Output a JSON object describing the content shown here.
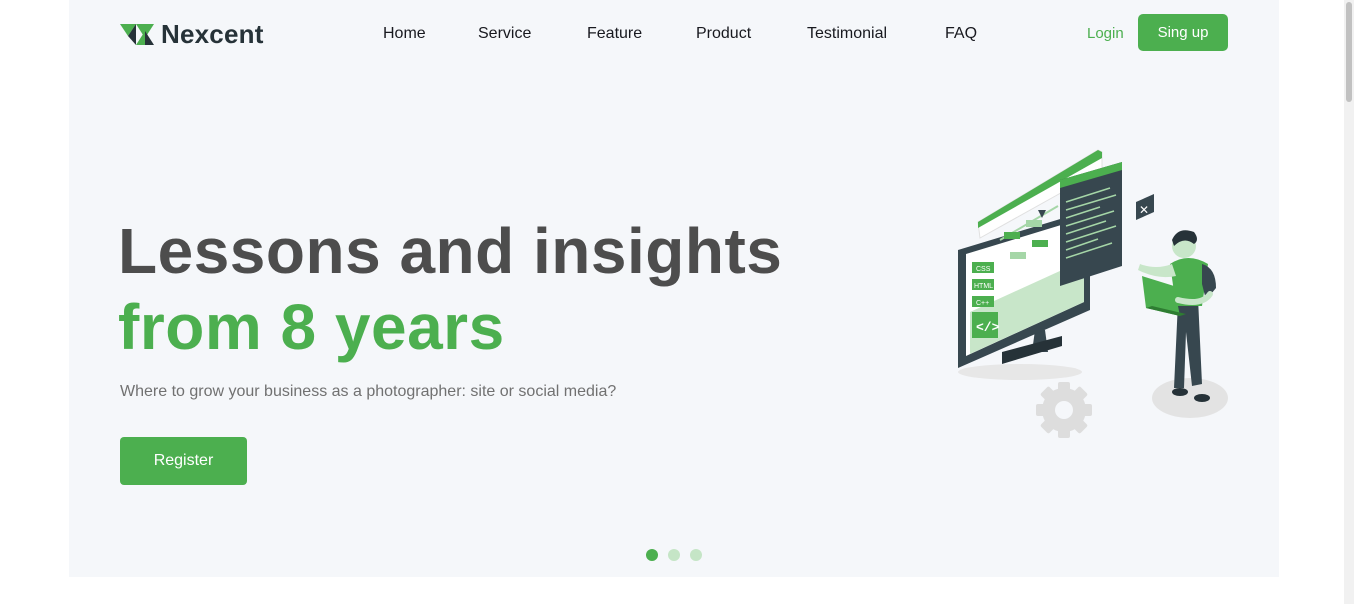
{
  "brand": {
    "name": "Nexcent",
    "accent": "#4caf4f",
    "dark": "#263238"
  },
  "nav": {
    "items": [
      {
        "label": "Home"
      },
      {
        "label": "Service"
      },
      {
        "label": "Feature"
      },
      {
        "label": "Product"
      },
      {
        "label": "Testimonial"
      },
      {
        "label": "FAQ"
      }
    ],
    "login": "Login",
    "signup": "Sing up"
  },
  "hero": {
    "headline_line1": "Lessons and insights",
    "headline_line2": "from 8 years",
    "subtitle": "Where to grow your business as a photographer: site or social media?",
    "cta": "Register",
    "illustration_icon": "developer-illustration",
    "code_tags": [
      "CSS",
      "HTML",
      "C++"
    ]
  },
  "carousel": {
    "slide_count": 3,
    "active_index": 0
  }
}
